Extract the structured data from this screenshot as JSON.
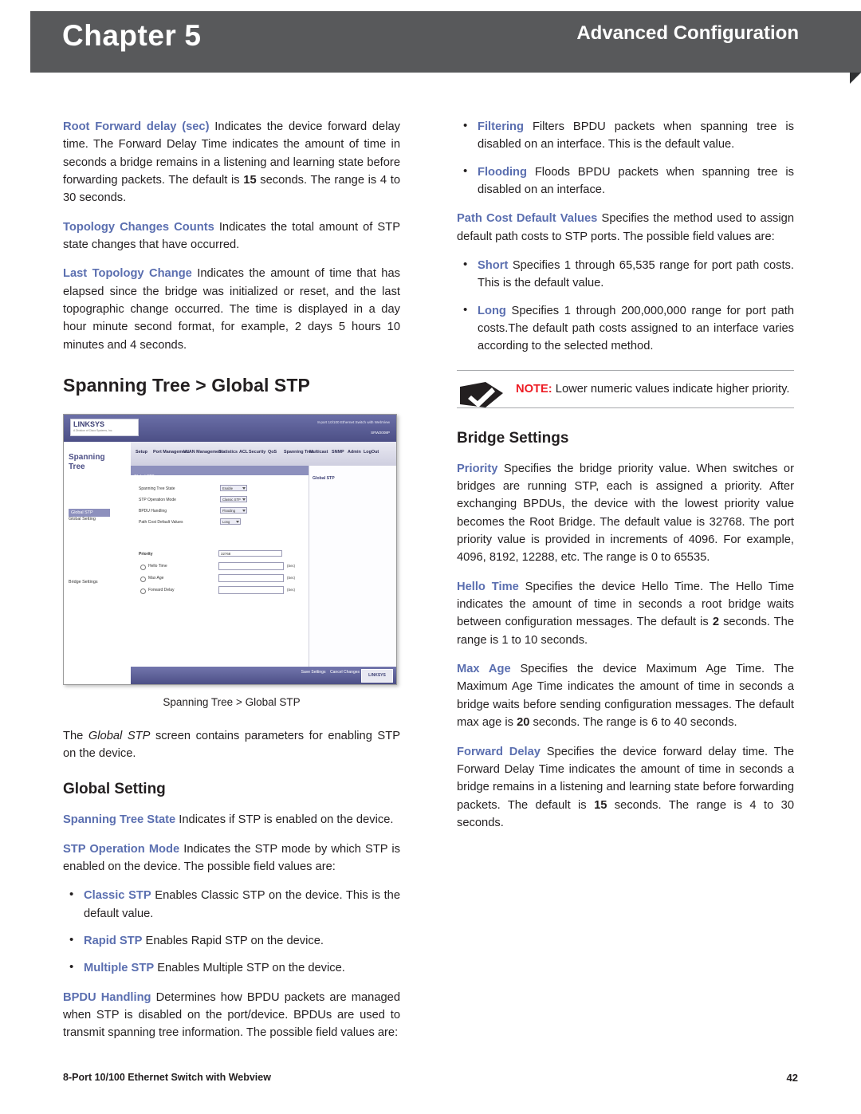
{
  "header": {
    "chapter_word": "Chapter",
    "chapter_number": "5",
    "section_title": "Advanced Configuration"
  },
  "left_column": {
    "p1_term": "Root Forward delay (sec)",
    "p1_text": " Indicates the device forward delay time. The Forward Delay Time indicates the amount of time in seconds a bridge remains in a listening and learning state before forwarding packets. The default is ",
    "p1_bold": "15",
    "p1_tail": " seconds. The range is 4 to 30 seconds.",
    "p2_term": "Topology Changes Counts",
    "p2_text": "  Indicates the total amount of STP state changes that have occurred.",
    "p3_term": "Last Topology Change",
    "p3_text": "  Indicates the amount of time that has elapsed since the bridge was initialized or reset, and the last topographic change occurred. The time is displayed in a day hour minute second format, for example, 2 days 5 hours 10 minutes and 4 seconds.",
    "heading_spanning_tree": "Spanning Tree > Global STP",
    "figure_caption": "Spanning Tree > Global STP",
    "p4_pre": "The ",
    "p4_italic": "Global STP",
    "p4_post": " screen contains parameters for enabling STP on the device.",
    "heading_global_setting": "Global Setting",
    "p5_term": "Spanning Tree State",
    "p5_text": "  Indicates if STP is enabled on the device.",
    "p6_term": "STP Operation Mode",
    "p6_text": "  Indicates the STP mode by which STP is enabled on the device. The possible field values are:",
    "bullets": [
      {
        "term": "Classic STP",
        "text": "  Enables Classic STP on the device. This is the default value."
      },
      {
        "term": "Rapid STP",
        "text": "  Enables Rapid STP on the device."
      },
      {
        "term": "Multiple STP",
        "text": "  Enables Multiple STP on the device."
      }
    ],
    "p7_term": "BPDU Handling",
    "p7_text": "  Determines how BPDU packets are managed when STP is disabled on the port/device. BPDUs are used to transmit spanning tree information. The possible field values are:"
  },
  "right_column": {
    "bullets_top": [
      {
        "term": "Filtering",
        "text": "  Filters BPDU packets when spanning tree is disabled on an interface. This is the default value."
      },
      {
        "term": "Flooding",
        "text": "  Floods BPDU packets when spanning tree is disabled on an interface."
      }
    ],
    "p1_term": "Path Cost Default Values",
    "p1_text": "  Specifies the method used to assign default path costs to STP ports. The possible field values are:",
    "bullets_mid": [
      {
        "term": "Short",
        "text": "  Specifies 1 through 65,535 range for port path costs. This is the default value."
      },
      {
        "term": "Long",
        "text": "  Specifies 1 through 200,000,000 range for port path costs.The default path costs assigned to an interface varies according to the selected method."
      }
    ],
    "note_label": "NOTE:",
    "note_text": " Lower numeric values indicate higher priority.",
    "heading_bridge_settings": "Bridge Settings",
    "p2_term": "Priority",
    "p2_text": "  Specifies the bridge priority value. When switches or bridges are running STP, each is assigned a priority. After exchanging BPDUs, the device with the lowest priority value becomes the Root Bridge. The default value is 32768. The port priority value is provided in increments of 4096. For example, 4096, 8192, 12288, etc. The range is 0 to 65535.",
    "p3_term": "Hello Time",
    "p3_text": "  Specifies the device Hello Time. The Hello Time indicates the amount of time in seconds a root bridge waits between configuration messages. The default is ",
    "p3_bold": "2",
    "p3_tail": " seconds. The range is 1 to 10 seconds.",
    "p4_term": "Max Age",
    "p4_text": "  Specifies the device Maximum Age Time. The Maximum Age Time indicates the amount of time in seconds a bridge waits before sending configuration messages. The default max age is ",
    "p4_bold": "20",
    "p4_tail": " seconds. The range is 6 to 40 seconds.",
    "p5_term": "Forward Delay",
    "p5_text": "  Specifies the device forward delay time. The Forward Delay Time indicates the amount of time in seconds a bridge remains in a listening and learning state before forwarding packets. The default is ",
    "p5_bold": "15",
    "p5_tail": " seconds. The range is 4 to 30 seconds."
  },
  "screenshot": {
    "logo": "LINKSYS",
    "logo_sub": "A Division of Cisco Systems, Inc.",
    "nav_title_line1": "Spanning",
    "nav_title_line2": "Tree",
    "nav_items": [
      "Global STP",
      "Global Setting"
    ],
    "nav_left_label": "Bridge Settings",
    "menu_items": [
      "Setup",
      "Port Management",
      "VLAN Management",
      "Statistics",
      "ACL",
      "Security",
      "QoS",
      "Spanning Tree",
      "Multicast",
      "SNMP",
      "Admin",
      "LogOut"
    ],
    "panel_title": "Global STP",
    "fields": [
      {
        "label": "Spanning Tree State",
        "value": "Enable"
      },
      {
        "label": "STP Operation Mode",
        "value": "Classic STP"
      },
      {
        "label": "BPDU Handling",
        "value": "Flooding"
      },
      {
        "label": "Path Cost Default Values",
        "value": "Long"
      }
    ],
    "bridge_group_label": "Bridge Settings",
    "bridge_fields": [
      {
        "label": "Priority",
        "value": "32768",
        "unit": ""
      },
      {
        "label": "Hello Time",
        "value": "",
        "unit": "(Sec)"
      },
      {
        "label": "Max Age",
        "value": "",
        "unit": "(Sec)"
      },
      {
        "label": "Forward Delay",
        "value": "",
        "unit": "(Sec)"
      }
    ],
    "buttons": [
      "Save Settings",
      "Cancel Changes"
    ],
    "footer_logo": "LINKSYS",
    "help_title": "Global STP",
    "topright": "8-port 10/100 Ethernet Switch with WebView",
    "device_model": "SRW2008P"
  },
  "footer": {
    "product": "8-Port 10/100 Ethernet Switch with Webview",
    "page_number": "42"
  }
}
